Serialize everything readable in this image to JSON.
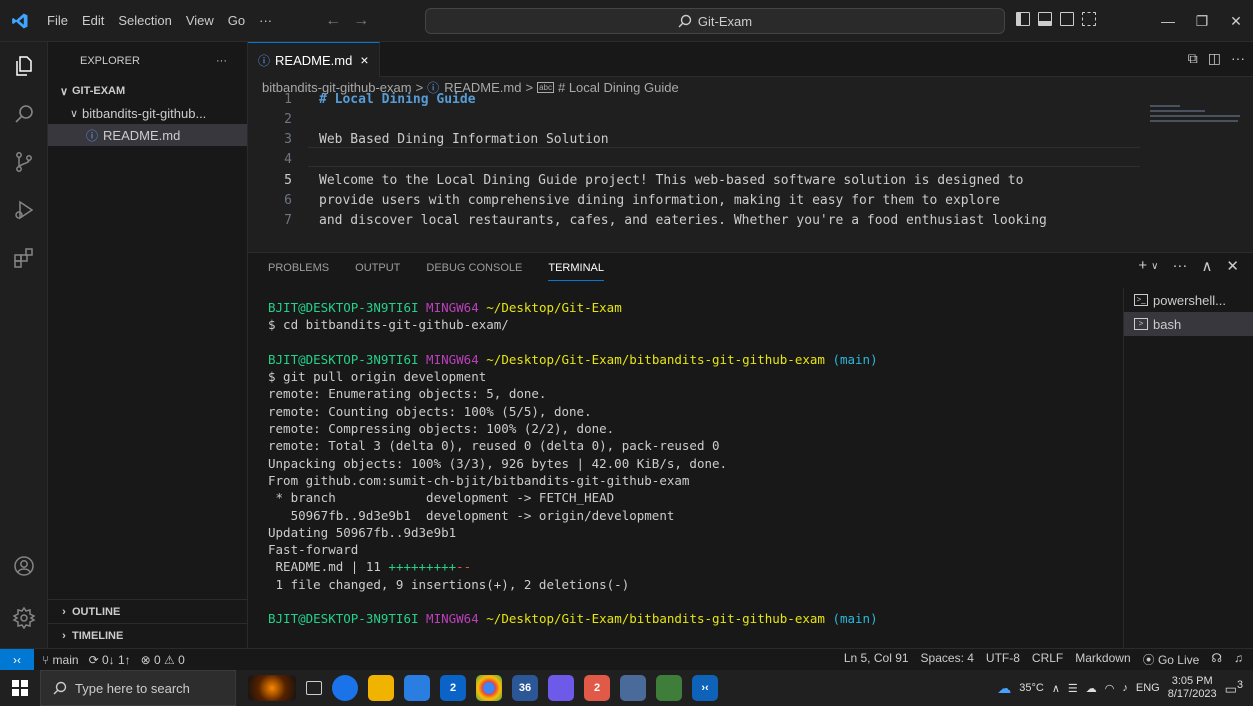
{
  "titlebar": {
    "menu": [
      "File",
      "Edit",
      "Selection",
      "View",
      "Go",
      "···"
    ],
    "search": "Git-Exam"
  },
  "sidebar": {
    "title": "EXPLORER",
    "more": "···",
    "root": "GIT-EXAM",
    "folder": "bitbandits-git-github...",
    "file": "README.md",
    "outline": "OUTLINE",
    "timeline": "TIMELINE"
  },
  "editor": {
    "tab_label": "README.md",
    "tab_close": "×",
    "breadcrumb": [
      "bitbandits-git-github-exam",
      ">",
      "README.md",
      ">",
      "# Local Dining Guide"
    ],
    "lines": [
      {
        "num": "1",
        "text": "# Local Dining Guide"
      },
      {
        "num": "2",
        "text": ""
      },
      {
        "num": "3",
        "text": "Web Based Dining Information Solution"
      },
      {
        "num": "4",
        "text": ""
      },
      {
        "num": "5",
        "text": "Welcome to the Local Dining Guide project! This web-based software solution is designed to"
      },
      {
        "num": "6",
        "text": "provide users with comprehensive dining information, making it easy for them to explore"
      },
      {
        "num": "7",
        "text": "and discover local restaurants, cafes, and eateries. Whether you're a food enthusiast looking"
      }
    ]
  },
  "panel": {
    "tabs": [
      "PROBLEMS",
      "OUTPUT",
      "DEBUG CONSOLE",
      "TERMINAL"
    ],
    "terminal": {
      "prompt_user": "BJIT@DESKTOP-3N9TI6I",
      "prompt_env": "MINGW64",
      "path1": "~/Desktop/Git-Exam",
      "cmd1": "$ cd bitbandits-git-github-exam/",
      "path2": "~/Desktop/Git-Exam/bitbandits-git-github-exam",
      "branch": "(main)",
      "cmd2": "$ git pull origin development",
      "out": [
        "remote: Enumerating objects: 5, done.",
        "remote: Counting objects: 100% (5/5), done.",
        "remote: Compressing objects: 100% (2/2), done.",
        "remote: Total 3 (delta 0), reused 0 (delta 0), pack-reused 0",
        "Unpacking objects: 100% (3/3), 926 bytes | 42.00 KiB/s, done.",
        "From github.com:sumit-ch-bjit/bitbandits-git-github-exam",
        " * branch            development -> FETCH_HEAD",
        "   50967fb..9d3e9b1  development -> origin/development",
        "Updating 50967fb..9d3e9b1",
        "Fast-forward"
      ],
      "stat_file": " README.md | 11 ",
      "stat_plus": "+++++++++",
      "stat_minus": "--",
      "summary": " 1 file changed, 9 insertions(+), 2 deletions(-)"
    },
    "shells": [
      "powershell...",
      "bash"
    ]
  },
  "statusbar": {
    "branch": "main",
    "sync": "0↓ 1↑",
    "problems": "⊗ 0 ⚠ 0",
    "position": "Ln 5, Col 91",
    "spaces": "Spaces: 4",
    "encoding": "UTF-8",
    "eol": "CRLF",
    "language": "Markdown",
    "golive": "Go Live"
  },
  "taskbar": {
    "search_placeholder": "Type here to search",
    "weather": "35°C",
    "lang": "ENG",
    "time": "3:05 PM",
    "date": "8/17/2023",
    "badges": {
      "mail": "2",
      "app36": "36",
      "app2": "2",
      "notif": "3"
    }
  }
}
